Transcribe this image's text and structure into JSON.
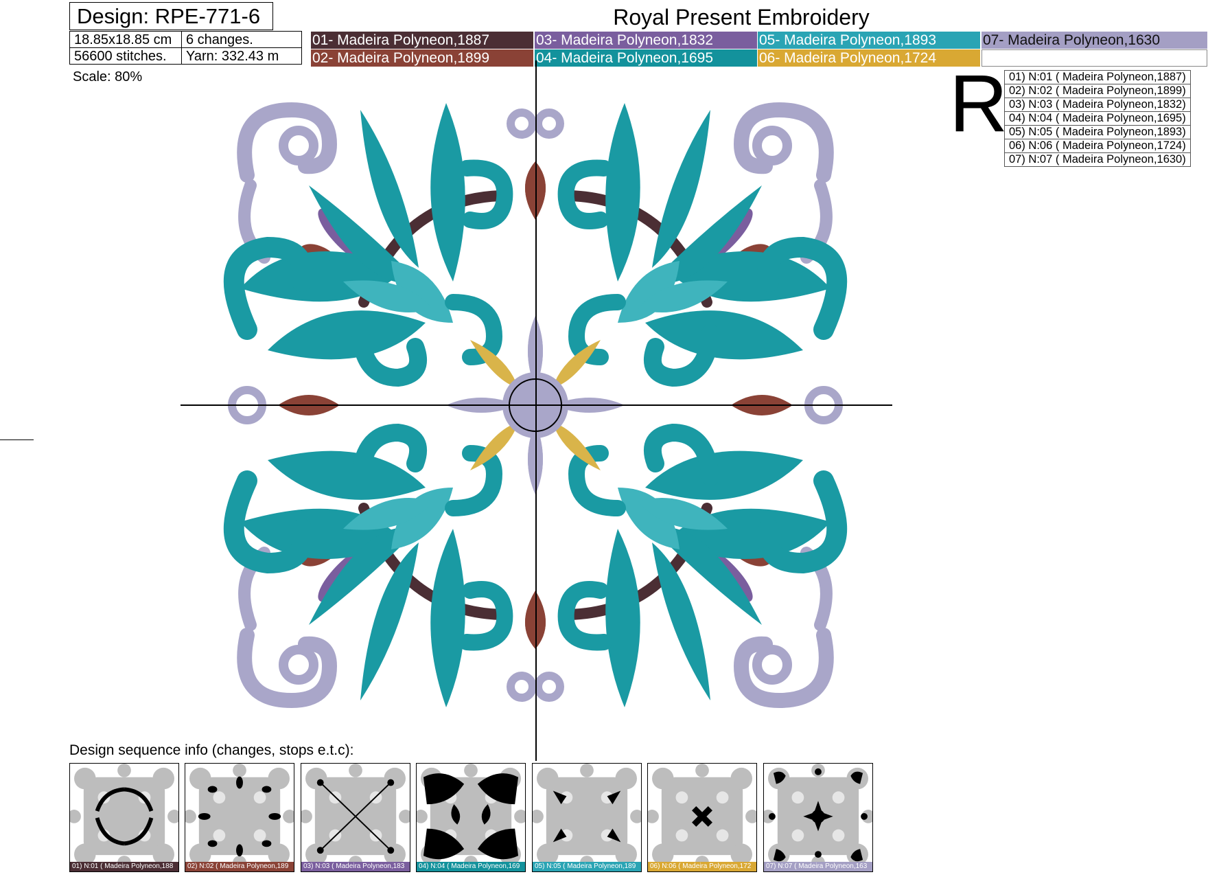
{
  "design": {
    "label": "Design: RPE-771-6",
    "title": "Royal Present Embroidery"
  },
  "info": {
    "size": "18.85x18.85 cm",
    "changes": "6 changes.",
    "stitches": "56600 stitches.",
    "yarn": "Yarn: 332.43 m"
  },
  "palette": [
    {
      "label": "01- Madeira Polyneon,1887",
      "color": "#4b2e34"
    },
    {
      "label": "02- Madeira Polyneon,1899",
      "color": "#8a4236"
    },
    {
      "label": "03- Madeira Polyneon,1832",
      "color": "#7a5e9e"
    },
    {
      "label": "04- Madeira Polyneon,1695",
      "color": "#13929c"
    },
    {
      "label": "05- Madeira Polyneon,1893",
      "color": "#2aa4b4"
    },
    {
      "label": "06- Madeira Polyneon,1724",
      "color": "#d9a833"
    },
    {
      "label": "07- Madeira Polyneon,1630",
      "color": "#a49fc4"
    }
  ],
  "scale": "Scale: 80%",
  "big_letter": "R",
  "legend": [
    "01) N:01 ( Madeira Polyneon,1887)",
    "02) N:02 ( Madeira Polyneon,1899)",
    "03) N:03 ( Madeira Polyneon,1832)",
    "04) N:04 ( Madeira Polyneon,1695)",
    "05) N:05 ( Madeira Polyneon,1893)",
    "06) N:06 ( Madeira Polyneon,1724)",
    "07) N:07 ( Madeira Polyneon,1630)"
  ],
  "sequence_title": "Design sequence info (changes, stops e.t.c):",
  "thumbnails": [
    {
      "caption": "01) N:01 ( Madeira Polyneon,188",
      "color": "#4b2e34"
    },
    {
      "caption": "02) N:02 ( Madeira Polyneon,189",
      "color": "#8a4236"
    },
    {
      "caption": "03) N:03 ( Madeira Polyneon,183",
      "color": "#7a5e9e"
    },
    {
      "caption": "04) N:04 ( Madeira Polyneon,169",
      "color": "#13929c"
    },
    {
      "caption": "05) N:05 ( Madeira Polyneon,189",
      "color": "#2aa4b4"
    },
    {
      "caption": "06) N:06 ( Madeira Polyneon,172",
      "color": "#d9a833"
    },
    {
      "caption": "07) N:07 ( Madeira Polyneon,163",
      "color": "#a49fc4"
    }
  ],
  "colors": {
    "teal": "#1a9aa3",
    "teal_light": "#3fb4bd",
    "lavender": "#a9a6c9",
    "brown": "#8a4236",
    "dark": "#4b2e34",
    "gold": "#d9b44a",
    "purple": "#7a5e9e"
  }
}
